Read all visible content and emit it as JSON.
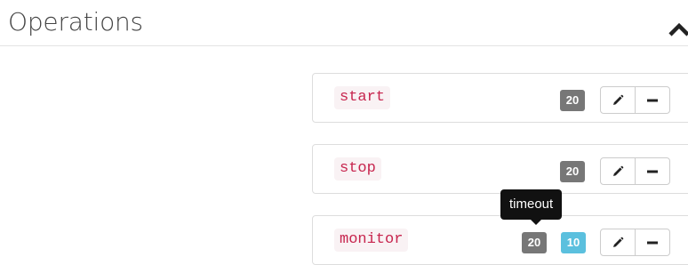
{
  "section": {
    "title": "Operations",
    "toggle_icon": "chevron-up-icon"
  },
  "operations": [
    {
      "name": "start",
      "badges": [
        {
          "value": "20",
          "style": "gray",
          "color": "#777777"
        }
      ]
    },
    {
      "name": "stop",
      "badges": [
        {
          "value": "20",
          "style": "gray",
          "color": "#777777"
        }
      ]
    },
    {
      "name": "monitor",
      "badges": [
        {
          "value": "20",
          "style": "gray",
          "color": "#777777"
        },
        {
          "value": "10",
          "style": "info",
          "color": "#5bc0de"
        }
      ]
    }
  ],
  "buttons": {
    "edit_icon": "pencil-icon",
    "remove_icon": "minus-icon"
  },
  "tooltip": {
    "text": "timeout"
  },
  "colors": {
    "code_text": "#c7254e",
    "code_bg": "#f9f2f4",
    "badge_default": "#777777",
    "badge_info": "#5bc0de"
  }
}
